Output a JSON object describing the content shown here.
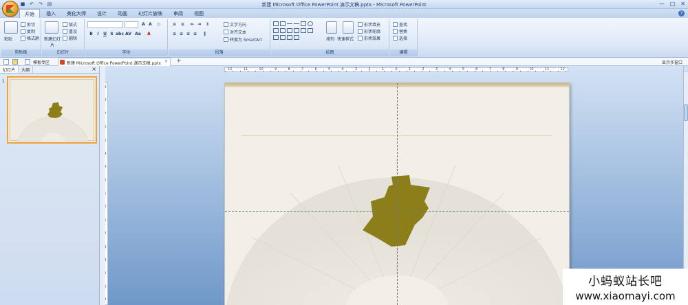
{
  "window": {
    "title": "新建 Microsoft Office PowerPoint 演示文稿.pptx - Microsoft PowerPoint"
  },
  "quick_access": [
    "save-icon",
    "undo-icon",
    "redo-icon",
    "print-preview-icon"
  ],
  "tabs": [
    {
      "label": "开始",
      "active": true
    },
    {
      "label": "插入"
    },
    {
      "label": "美化大师"
    },
    {
      "label": "设计"
    },
    {
      "label": "动画"
    },
    {
      "label": "幻灯片放映"
    },
    {
      "label": "审阅"
    },
    {
      "label": "视图"
    }
  ],
  "ribbon": {
    "clipboard": {
      "label": "剪贴板",
      "paste": "粘贴",
      "cut": "剪切",
      "copy": "复制",
      "format_painter": "格式刷"
    },
    "slides": {
      "label": "幻灯片",
      "new_slide": "新建幻灯片",
      "layout": "版式",
      "reset": "重设",
      "delete": "删除"
    },
    "font": {
      "label": "字体"
    },
    "paragraph": {
      "label": "段落",
      "text_direction": "文字方向",
      "align_text": "对齐文本",
      "smartart": "转换为 SmartArt"
    },
    "drawing": {
      "label": "绘图",
      "arrange": "排列",
      "quick_styles": "快速样式",
      "shape_fill": "形状填充",
      "shape_outline": "形状轮廓",
      "shape_effects": "形状效果"
    },
    "editing": {
      "label": "编辑",
      "find": "查找",
      "replace": "替换",
      "select": "选择"
    }
  },
  "doc_bar": {
    "template_area": "模板专区",
    "doc_tab": "新建 Microsoft Office PowerPoint 演示文稿.pptx",
    "multi_window": "显示多窗口"
  },
  "left_pane": {
    "tab_slides": "幻灯片",
    "tab_outline": "大纲",
    "slide_number": "1"
  },
  "ruler": {
    "top": [
      "12",
      "11",
      "10",
      "9",
      "8",
      "7",
      "6",
      "5",
      "4",
      "3",
      "2",
      "1",
      "0",
      "1",
      "2",
      "3",
      "4",
      "5",
      "6",
      "7",
      "8",
      "9",
      "10",
      "11",
      "12"
    ],
    "left": [
      "9",
      "8",
      "7",
      "6",
      "5",
      "4",
      "3",
      "2",
      "1",
      "0",
      "1",
      "2",
      "3",
      "4",
      "5",
      "6",
      "7"
    ]
  },
  "colors": {
    "shape_fill": "#8c7f1a",
    "accent_selected": "#f0a23a"
  },
  "watermark": {
    "line1": "小蚂蚁站长吧",
    "line2": "www.xiaomayi.com"
  }
}
